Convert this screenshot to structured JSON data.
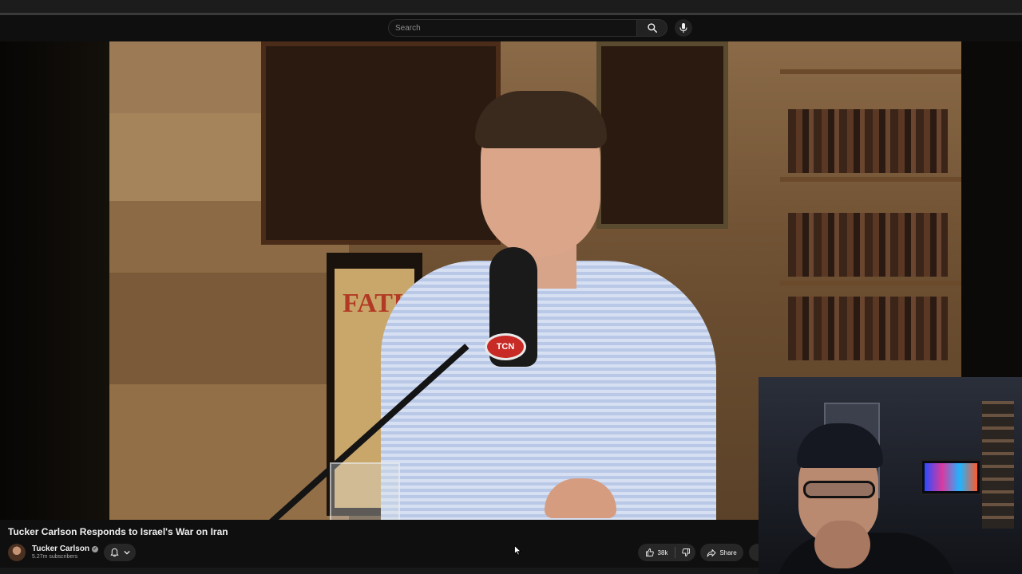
{
  "search": {
    "placeholder": "Search"
  },
  "video": {
    "title": "Tucker Carlson Responds to Israel's War on Iran"
  },
  "scene": {
    "poster_text": "FATI",
    "mic_badge": "TCN"
  },
  "channel": {
    "name": "Tucker Carlson",
    "subscribers": "5.27m subscribers"
  },
  "actions": {
    "like_count": "38k",
    "share_label": "Share"
  },
  "icons": [
    "search-icon",
    "mic-icon",
    "bell-icon",
    "chevron-down-icon",
    "thumbs-up-icon",
    "thumbs-down-icon",
    "share-icon",
    "verified-icon"
  ],
  "colors": {
    "background": "#0f0f0f",
    "button": "#272727",
    "text": "#f1f1f1",
    "secondary_text": "#aaaaaa"
  }
}
